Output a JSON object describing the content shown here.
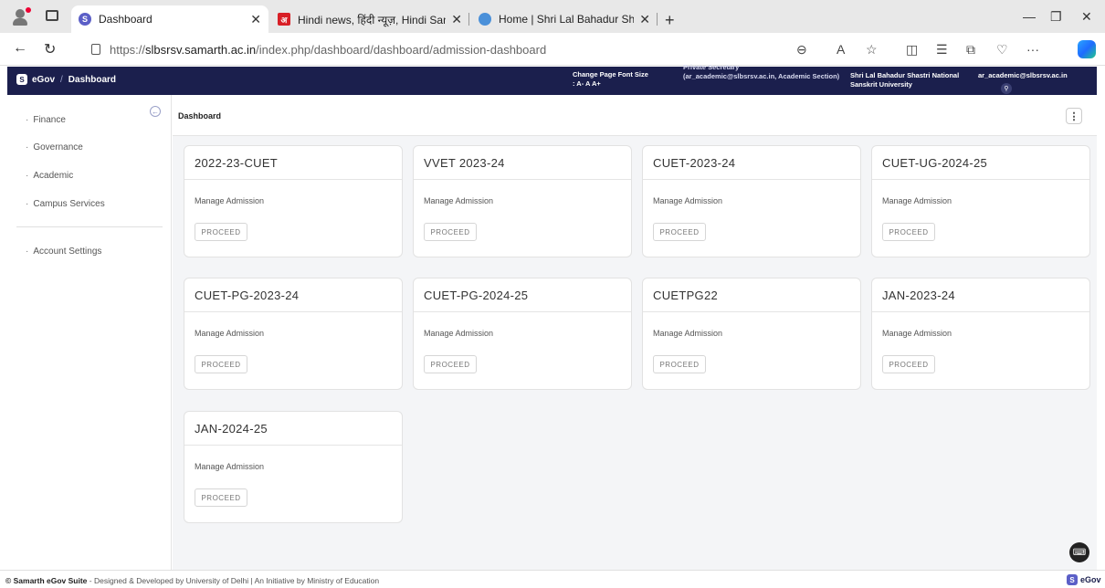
{
  "browser": {
    "tabs": [
      {
        "title": "Dashboard",
        "favicon_letter": "S",
        "favicon_color": "#5b5fc7"
      },
      {
        "title": "Hindi news, हिंदी न्यूज़, Hindi Sama",
        "favicon_letter": "अ",
        "favicon_color": "#d81f26"
      },
      {
        "title": "Home | Shri Lal Bahadur Shastri N",
        "favicon_letter": "",
        "favicon_color": "#4a90d9"
      }
    ],
    "url_prefix": "https://",
    "url_host": "slbsrsv.samarth.ac.in",
    "url_path": "/index.php/dashboard/dashboard/admission-dashboard"
  },
  "header": {
    "brand": "eGov",
    "brand_logo": "S",
    "crumb": "Dashboard",
    "font_size_label": "Change Page Font Size",
    "font_size_controls": ": A- A A+",
    "role_title": "Private Secretary",
    "role_detail": "(ar_academic@slbsrsv.ac.in, Academic Section)",
    "university": "Shri Lal Bahadur Shastri National Sanskrit University",
    "user_email": "ar_academic@slbsrsv.ac.in"
  },
  "sidebar": {
    "items": [
      {
        "label": "Finance"
      },
      {
        "label": "Governance"
      },
      {
        "label": "Academic"
      },
      {
        "label": "Campus Services"
      }
    ],
    "account": "Account Settings"
  },
  "content": {
    "title": "Dashboard",
    "cards": [
      {
        "title": "2022-23-CUET",
        "subtitle": "Manage Admission",
        "button": "PROCEED"
      },
      {
        "title": "VVET 2023-24",
        "subtitle": "Manage Admission",
        "button": "PROCEED"
      },
      {
        "title": "CUET-2023-24",
        "subtitle": "Manage Admission",
        "button": "PROCEED"
      },
      {
        "title": "CUET-UG-2024-25",
        "subtitle": "Manage Admission",
        "button": "PROCEED"
      },
      {
        "title": "CUET-PG-2023-24",
        "subtitle": "Manage Admission",
        "button": "PROCEED"
      },
      {
        "title": "CUET-PG-2024-25",
        "subtitle": "Manage Admission",
        "button": "PROCEED"
      },
      {
        "title": "CUETPG22",
        "subtitle": "Manage Admission",
        "button": "PROCEED"
      },
      {
        "title": "JAN-2023-24",
        "subtitle": "Manage Admission",
        "button": "PROCEED"
      },
      {
        "title": "JAN-2024-25",
        "subtitle": "Manage Admission",
        "button": "PROCEED"
      }
    ]
  },
  "footer": {
    "brand_text": "© Samarth eGov Suite",
    "text": " - Designed & Developed by University of Delhi | An Initiative by Ministry of Education",
    "logo_brand": "eGov",
    "logo_letter": "S"
  },
  "colors": {
    "header_bg": "#1b1f4d",
    "content_bg": "#f4f5f7",
    "accent": "#5b5fc7"
  }
}
